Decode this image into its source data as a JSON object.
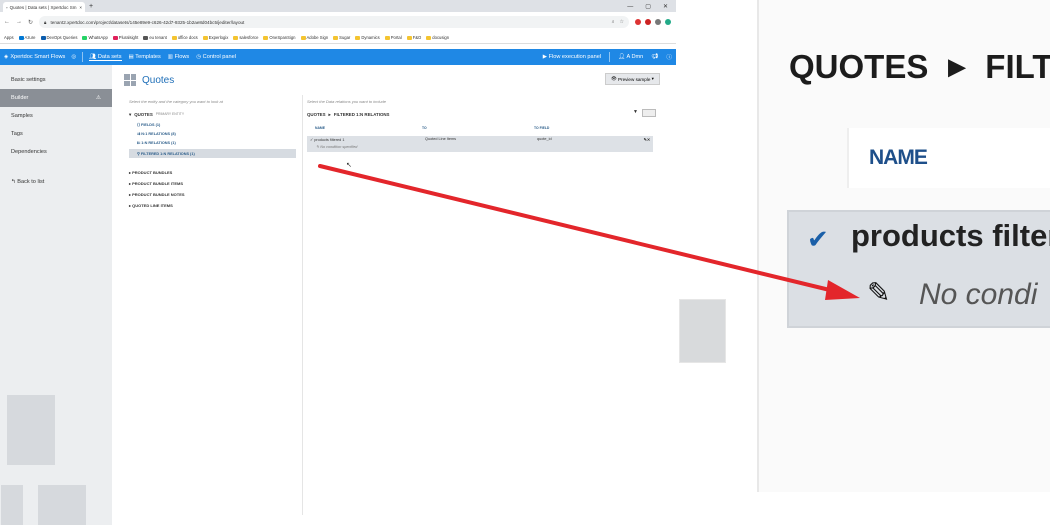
{
  "browser": {
    "tab_title": "Quotes | Data sets | Xpertdoc Sm",
    "tab_close": "×",
    "new_tab": "+",
    "url": "tenant2.xpertdoc.com/project/datasets/145e89e9-c626-42d7-9325-1b2ae8d04bc5/jediter/layout",
    "window_controls": [
      "—",
      "▢",
      "✕"
    ],
    "bookmarks": [
      "Apps",
      "Azure",
      "DevOps Queries",
      "WhatsApp",
      "Pluralsight",
      "eu tenant",
      "office docs",
      "Experlogix",
      "salesforce",
      "OneSpanSign",
      "Adobe Sign",
      "Sugar",
      "Dynamics",
      "Portal",
      "F&O",
      "docusign"
    ]
  },
  "appbar": {
    "brand": "Xpertdoc Smart Flows",
    "nav": [
      "Data sets",
      "Templates",
      "Flows",
      "Control panel"
    ],
    "flow_panel": "Flow execution panel",
    "user": "A Dmn"
  },
  "sidebar": {
    "items": [
      "Basic settings",
      "Builder",
      "Samples",
      "Tags",
      "Dependencies"
    ],
    "back": "Back to list"
  },
  "main": {
    "title": "Quotes",
    "preview_button": "Preview sample",
    "left_hint": "Select the entity and the category you want to look at",
    "tree_root": "QUOTES",
    "tree_root_note": "PRIMARY ENTITY",
    "tree_children": [
      "FIELDS (1)",
      "N:1 RELATIONS (8)",
      "1:N RELATIONS (1)",
      "FILTERED 1:N RELATIONS (1)"
    ],
    "entities": [
      "PRODUCT BUNDLES",
      "PRODUCT BUNDLE ITEMS",
      "PRODUCT BUNDLE NOTES",
      "QUOTED LINE ITEMS"
    ],
    "right_hint": "Select the Data relations you want to include",
    "crumb": [
      "QUOTES",
      "FILTERED 1:N RELATIONS"
    ],
    "columns": [
      "NAME",
      "TO",
      "TO FIELD"
    ],
    "row": {
      "name": "products filtered 1",
      "to": "Quoted Line Items",
      "to_field": "quote_id",
      "condition": "No condition specified"
    }
  },
  "zoom": {
    "crumb_a": "QUOTES",
    "crumb_b": "FILTE",
    "col_header": "NAME",
    "row_name": "products filter",
    "row_condition": "No condi"
  },
  "colors": {
    "appbar": "#1f88e5",
    "arrow": "#e3262b",
    "selected_row": "#dbdfe4"
  }
}
